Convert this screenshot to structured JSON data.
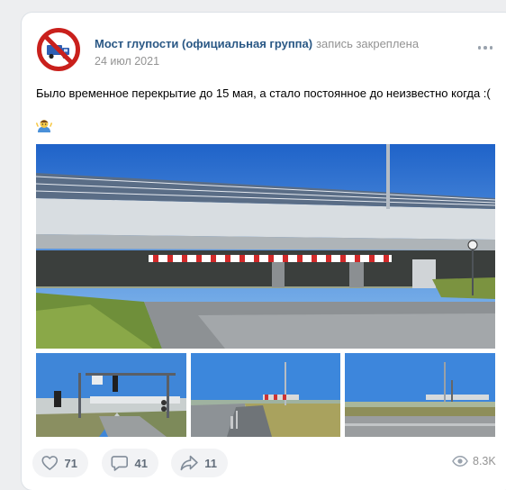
{
  "post": {
    "group_name": "Мост глупости (официальная группа)",
    "pinned_note": "запись закреплена",
    "date": "24 июл 2021",
    "text": "Было временное перекрытие до 15 мая, а стало постоянное до неизвестно когда :(",
    "emoji_icon": "person-shrugging-icon"
  },
  "avatar": {
    "icon": "no-trucks-sign-icon",
    "ring_color": "#c9201c",
    "truck_color": "#2f5fb3"
  },
  "photos": [
    {
      "name": "bridge-main-photo"
    },
    {
      "name": "traffic-light-gate-photo"
    },
    {
      "name": "road-barrier-photo"
    },
    {
      "name": "bridge-from-road-photo"
    }
  ],
  "actions": {
    "likes": "71",
    "comments": "41",
    "shares": "11",
    "views": "8.3K"
  },
  "colors": {
    "link": "#2a5885",
    "secondary": "#939393",
    "action_bg": "#f2f3f5",
    "action_text": "#626d7a"
  }
}
